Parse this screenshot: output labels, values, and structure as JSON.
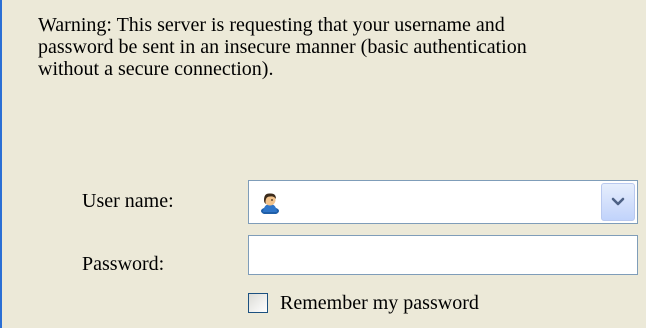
{
  "dialog": {
    "warning_text": "Warning: This server is requesting that your username and\npassword be sent in an insecure manner (basic authentication\nwithout a secure connection).",
    "username_label": "User name:",
    "username_value": "",
    "password_label": "Password:",
    "password_value": "",
    "remember_label": "Remember my password",
    "remember_checked": false
  },
  "icons": {
    "user": "user-account-icon",
    "dropdown": "chevron-down-icon"
  },
  "colors": {
    "dialog_background": "#ECE9D8",
    "frame_border": "#2B6FD5",
    "field_border": "#7F9DB9"
  }
}
